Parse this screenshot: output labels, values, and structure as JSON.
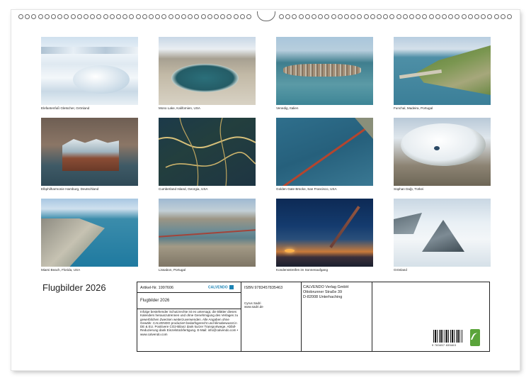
{
  "calendar_title": "Flugbilder 2026",
  "photos": [
    {
      "caption": "Elefantenfuß Gletscher, Grönland"
    },
    {
      "caption": "Mono Lake, Kalifornien, USA"
    },
    {
      "caption": "Venedig, Italien"
    },
    {
      "caption": "Funchal, Madeira, Portugal"
    },
    {
      "caption": "Elbphilharmonie Hamburg, Deutschland"
    },
    {
      "caption": "Cumberland Island, Georgia, USA"
    },
    {
      "caption": "Golden Gate Brücke, San Francisco, USA"
    },
    {
      "caption": "Süphan Dağı, Türkei"
    },
    {
      "caption": "Miami Beach, Florida, USA"
    },
    {
      "caption": "Lissabon, Portugal"
    },
    {
      "caption": "Kondensstreifen im Sonnenaufgang"
    },
    {
      "caption": "Grönland"
    }
  ],
  "info": {
    "article_no": "Artikel-Nr. 1997606",
    "product_title": "Flugbilder 2026",
    "legal_text": "Infolge bestehender Schutzrechte ist es untersagt, die Blätter dieses Kalenders herauszutrennen und ohne Genehmigung des Verlages zu gewerblichen Zwecken weiterzuverwenden. Alle Angaben ohne Gewähr. CALVENDO produziert bedarfsgerecht und klimabewusst in DE & EU. Positivere CO2-Bilanz dank kurzer Transportwege. Abfall-Reduzierung dank Einzelstückfertigung. E-Mail: info@calvendo.com • www.calvendo.com",
    "isbn": "ISBN 9783457835463",
    "author": "Cyrus Sadri",
    "author_web": "www.sadri.de",
    "publisher_name": "CALVENDO Verlag GmbH",
    "publisher_street": "Ottobrunner Straße 39",
    "publisher_city": "D-82008 Unterhaching",
    "logo_text": "CALVENDO",
    "barcode_number": "9 783457 835463"
  }
}
